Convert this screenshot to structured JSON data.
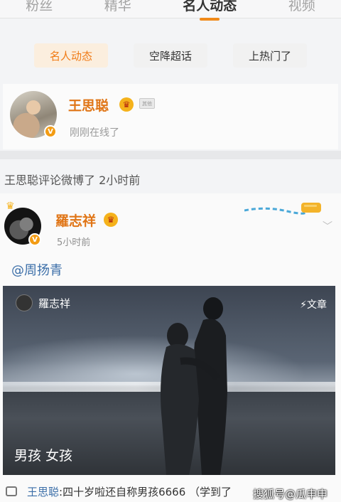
{
  "top_tabs": [
    "粉丝",
    "精华",
    "名人动态",
    "视频"
  ],
  "sub_tabs": [
    {
      "label": "名人动态",
      "active": true
    },
    {
      "label": "空降超话",
      "active": false
    },
    {
      "label": "上热门了",
      "active": false
    }
  ],
  "celebrity": {
    "name": "王思聪",
    "status": "刚刚在线了",
    "tag": "其他"
  },
  "activity": "王思聪评论微博了 2小时前",
  "post": {
    "author": "羅志祥",
    "time": "5小时前",
    "mention": "@周扬青",
    "photo_source": "羅志祥",
    "article_tag": "文章",
    "caption": "男孩 女孩"
  },
  "comment": {
    "author": "王思聪",
    "text": ":四十岁啦还自称男孩6666 （学到了"
  },
  "watermark": "搜狐号@瓜申申",
  "colors": {
    "accent_orange": "#e07516",
    "link_blue": "#3b6ea8",
    "badge_orange": "#f39c14"
  }
}
